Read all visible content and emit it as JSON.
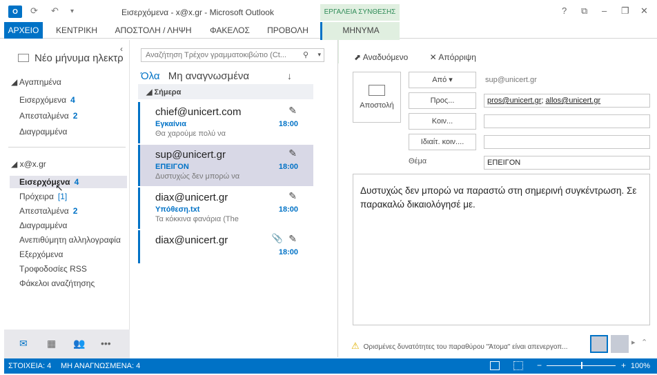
{
  "window": {
    "title": "Εισερχόμενα - x@x.gr - Microsoft Outlook",
    "app_icon": "O",
    "contextual_tab_group": "ΕΡΓΑΛΕΙΑ ΣΥΝΘΕΣΗΣ",
    "help": "?",
    "restore": "⧉",
    "minimize": "–",
    "maximize": "❐",
    "close": "✕"
  },
  "ribbon": {
    "tabs": [
      {
        "label": "ΑΡΧΕΙΟ"
      },
      {
        "label": "ΚΕΝΤΡΙΚΗ"
      },
      {
        "label": "ΑΠΟΣΤΟΛΗ / ΛΗΨΗ"
      },
      {
        "label": "ΦΑΚΕΛΟΣ"
      },
      {
        "label": "ΠΡΟΒΟΛΗ"
      },
      {
        "label": "ΜΗΝΥΜΑ"
      }
    ]
  },
  "nav": {
    "new_mail": "Νέο μήνυμα ηλεκτρ",
    "favorites_header": "Αγαπημένα",
    "favorites": [
      {
        "label": "Εισερχόμενα",
        "count": "4"
      },
      {
        "label": "Απεσταλμένα",
        "count": "2"
      },
      {
        "label": "Διαγραμμένα",
        "count": ""
      }
    ],
    "account_header": "x@x.gr",
    "folders": [
      {
        "label": "Εισερχόμενα",
        "count": "4"
      },
      {
        "label": "Πρόχειρα",
        "count": "[1]"
      },
      {
        "label": "Απεσταλμένα",
        "count": "2"
      },
      {
        "label": "Διαγραμμένα",
        "count": ""
      },
      {
        "label": "Ανεπιθύμητη αλληλογραφία",
        "count": ""
      },
      {
        "label": "Εξερχόμενα",
        "count": ""
      },
      {
        "label": "Τροφοδοσίες RSS",
        "count": ""
      },
      {
        "label": "Φάκελοι αναζήτησης",
        "count": ""
      }
    ]
  },
  "list": {
    "search_placeholder": "Αναζήτηση Τρέχον γραμματοκιβώτιο (Ct...",
    "filter_all": "Όλα",
    "filter_unread": "Μη αναγνωσμένα",
    "group_today": "Σήμερα",
    "messages": [
      {
        "from": "chief@unicert.com",
        "subject": "Εγκαίνια",
        "preview": "Θα χαρούμε πολύ να",
        "time": "18:00"
      },
      {
        "from": "sup@unicert.gr",
        "subject": "ΕΠΕΙΓΟΝ",
        "preview": "Δυστυχώς δεν μπορώ να",
        "time": "18:00"
      },
      {
        "from": "diax@unicert.gr",
        "subject": "Υπόθεση.txt",
        "preview": "Τα κόκκινα φανάρια (The",
        "time": "18:00"
      },
      {
        "from": "diax@unicert.gr",
        "subject": "",
        "preview": "",
        "time": "18:00"
      }
    ]
  },
  "compose": {
    "reply_label": "Αναδυόμενο",
    "discard_label": "Απόρριψη",
    "send_label": "Αποστολή",
    "from_btn": "Από ▾",
    "from_value": "sup@unicert.gr",
    "to_btn": "Προς...",
    "to_addr1": "pros@unicert.gr",
    "to_sep": "; ",
    "to_addr2": "allos@unicert.gr",
    "cc_btn": "Κοιν...",
    "bcc_btn": "Ιδιαίτ. κοιν....",
    "subject_label": "Θέμα",
    "subject_value": "ΕΠΕΙΓΟΝ",
    "body": "Δυστυχώς δεν μπορώ να παραστώ στη σημερινή συγκέντρωση. Σε παρακαλώ δικαιολόγησέ με.",
    "people_warning": "Ορισμένες δυνατότητες του παραθύρου \"Άτομα\" είναι απενεργοπ..."
  },
  "status": {
    "items": "ΣΤΟΙΧΕΙΑ: 4",
    "unread": "ΜΗ ΑΝΑΓΝΩΣΜΕΝΑ: 4",
    "zoom": "100%"
  },
  "colors": {
    "accent": "#0072c6",
    "contextual": "#e0efe0"
  }
}
